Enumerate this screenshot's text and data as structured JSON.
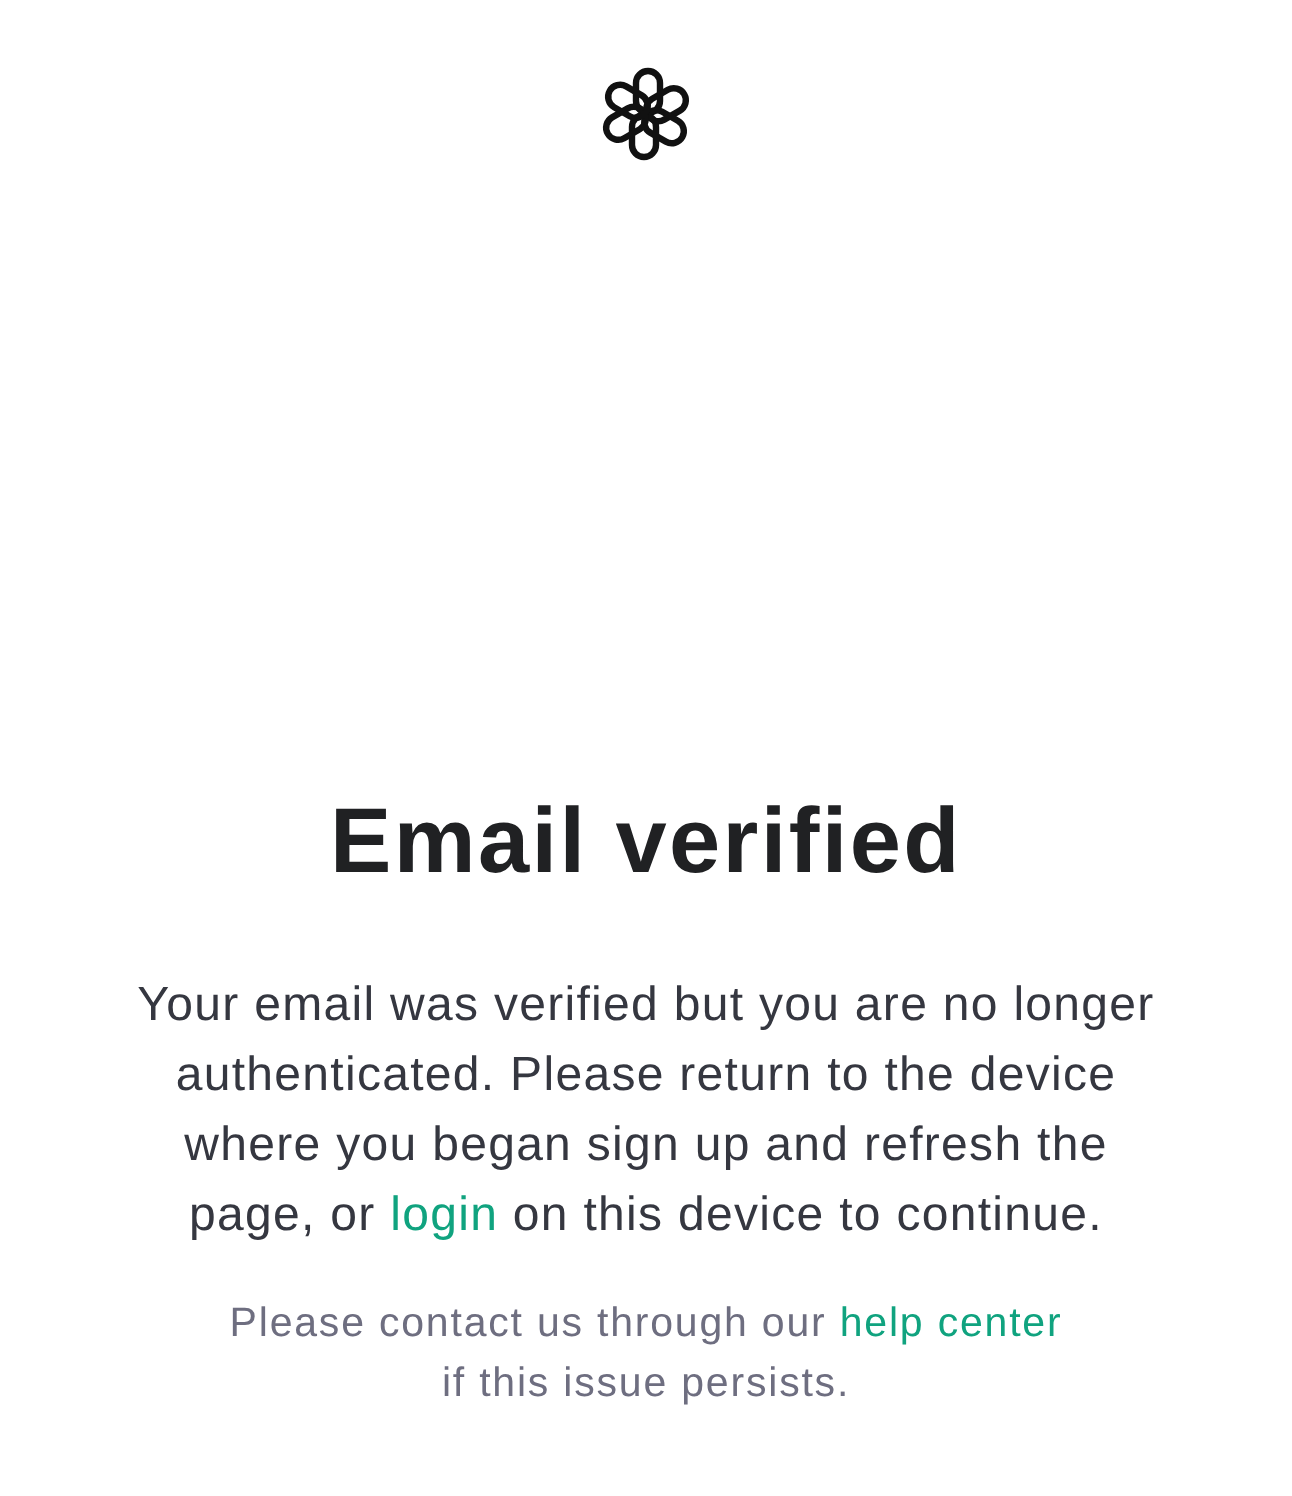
{
  "heading": "Email verified",
  "message": {
    "text_before": "Your email was verified but you are no longer authenticated. Please return to the device where you began sign up and refresh the page, or ",
    "link": "login",
    "text_after": " on this device to continue."
  },
  "help": {
    "text_before": "Please contact us through our ",
    "link": "help center",
    "text_after": " if this issue persists."
  }
}
